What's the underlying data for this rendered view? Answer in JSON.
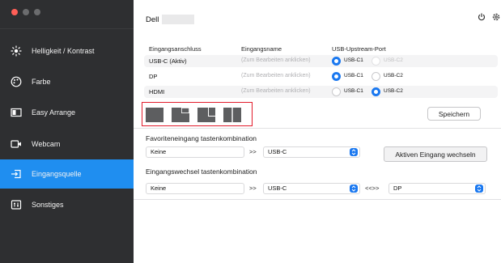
{
  "window": {
    "controls": [
      "close",
      "minimize",
      "zoom"
    ]
  },
  "sidebar": {
    "items": [
      {
        "label": "Helligkeit / Kontrast",
        "icon": "brightness-icon",
        "active": false
      },
      {
        "label": "Farbe",
        "icon": "palette-icon",
        "active": false
      },
      {
        "label": "Easy Arrange",
        "icon": "easy-arrange-icon",
        "active": false
      },
      {
        "label": "Webcam",
        "icon": "webcam-icon",
        "active": false
      },
      {
        "label": "Eingangsquelle",
        "icon": "input-source-icon",
        "active": true
      },
      {
        "label": "Sonstiges",
        "icon": "misc-icon",
        "active": false
      }
    ]
  },
  "header": {
    "title": "Dell",
    "icons": [
      "power-icon",
      "settings-icon"
    ]
  },
  "inputs_table": {
    "headers": [
      "Eingangsanschluss",
      "Eingangsname",
      "USB-Upstream-Port"
    ],
    "rows": [
      {
        "port": "USB-C (Aktiv)",
        "name_placeholder": "(Zum Bearbeiten anklicken)",
        "usb_options": [
          "USB-C1",
          "USB-C2"
        ],
        "selected": "USB-C1",
        "second_disabled": true
      },
      {
        "port": "DP",
        "name_placeholder": "(Zum Bearbeiten anklicken)",
        "usb_options": [
          "USB-C1",
          "USB-C2"
        ],
        "selected": "USB-C1",
        "second_disabled": false
      },
      {
        "port": "HDMI",
        "name_placeholder": "(Zum Bearbeiten anklicken)",
        "usb_options": [
          "USB-C1",
          "USB-C2"
        ],
        "selected": "USB-C2",
        "second_disabled": false
      }
    ]
  },
  "layout_presets": [
    "single-layout-icon",
    "pbp-corner-layout-icon",
    "pip-layout-icon",
    "split-layout-icon"
  ],
  "save_label": "Speichern",
  "favorite_shortcut": {
    "label": "Favoriteneingang tastenkombination",
    "key_value": "Keine",
    "arrow": ">>",
    "input_value": "USB-C",
    "button_label": "Aktiven Eingang wechseln"
  },
  "switch_shortcut": {
    "label": "Eingangswechsel tastenkombination",
    "key_value": "Keine",
    "arrow": ">>",
    "input_a": "USB-C",
    "swap": "<<>>",
    "input_b": "DP"
  },
  "colors": {
    "sidebar_bg": "#2e2f31",
    "accent": "#1f8ef0",
    "highlight_box": "#e21b2b"
  }
}
